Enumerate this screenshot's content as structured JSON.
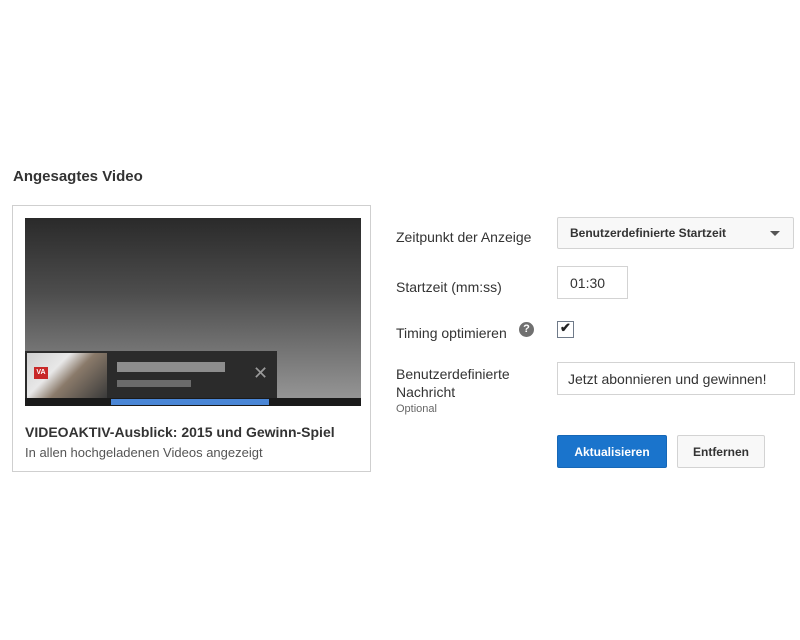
{
  "section": {
    "title": "Angesagtes Video"
  },
  "preview": {
    "logo_text": "VA",
    "close_glyph": "✕",
    "video_title": "VIDEOAKTIV-Ausblick: 2015 und Gewinn-Spiel",
    "video_subtitle": "In allen hochgeladenen Videos angezeigt",
    "progress_fraction": 0.47
  },
  "form": {
    "time_label": "Zeitpunkt der Anzeige",
    "time_select_value": "Benutzerdefinierte Startzeit",
    "start_label": "Startzeit (mm:ss)",
    "start_value": "01:30",
    "timing_label": "Timing optimieren",
    "timing_checked": true,
    "help_glyph": "?",
    "message_label": "Benutzerdefinierte Nachricht",
    "message_optional": "Optional",
    "message_value": "Jetzt abonnieren und gewinnen!",
    "update_button": "Aktualisieren",
    "remove_button": "Entfernen"
  },
  "colors": {
    "primary_button": "#1a74cc",
    "progress": "#4a86d6"
  },
  "icons": {
    "close": "close-icon",
    "help": "help-icon",
    "dropdown": "chevron-down-icon",
    "check": "checkmark-icon"
  }
}
